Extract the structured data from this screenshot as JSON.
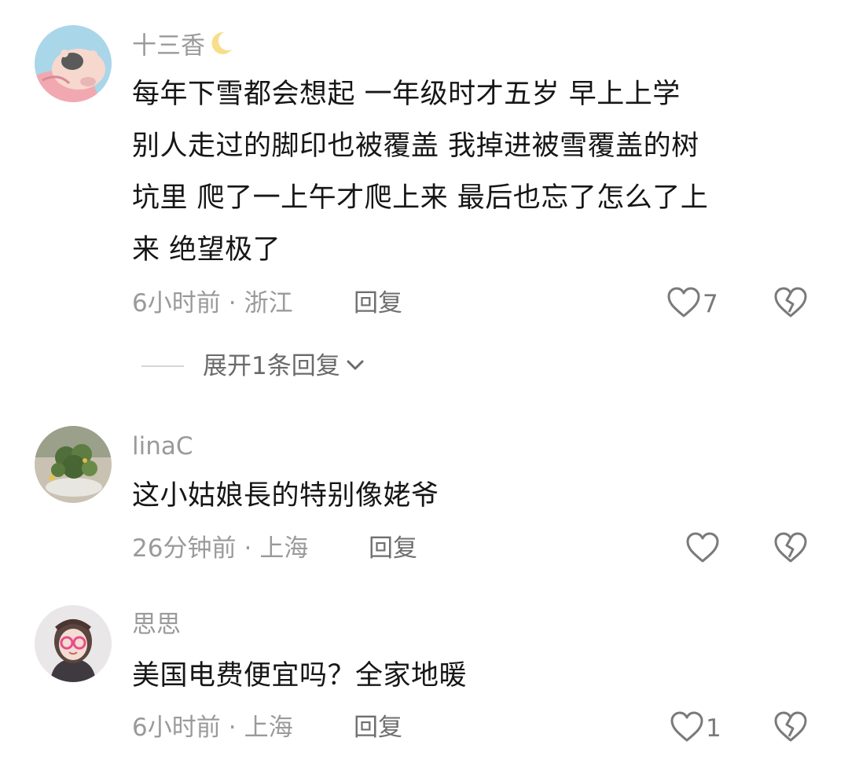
{
  "colors": {
    "text_primary": "#161616",
    "text_secondary": "#9a9a9a",
    "icon_gray": "#7a7a7a",
    "divider": "#d6d6d6"
  },
  "comments": [
    {
      "username": "十三香",
      "username_emoji": "crescent-moon-icon",
      "lines": [
        "每年下雪都会想起  一年级时才五岁  早上上学",
        "别人走过的脚印也被覆盖  我掉进被雪覆盖的树",
        "坑里  爬了一上午才爬上来 最后也忘了怎么了上",
        "来  绝望极了"
      ],
      "time": "6小时前",
      "location": "浙江",
      "reply_label": "回复",
      "like_count": "7",
      "expand_label": "展开1条回复"
    },
    {
      "username": "linaC",
      "lines": [
        "这小姑娘長的特别像姥爷"
      ],
      "time": "26分钟前",
      "location": "上海",
      "reply_label": "回复",
      "like_count": ""
    },
    {
      "username": "思思",
      "lines": [
        "美国电费便宜吗？全家地暖"
      ],
      "time": "6小时前",
      "location": "上海",
      "reply_label": "回复",
      "like_count": "1"
    }
  ],
  "meta_separator": "·",
  "icons": {
    "like": "heart-outline-icon",
    "dislike": "broken-heart-icon",
    "expand": "chevron-down-icon"
  }
}
